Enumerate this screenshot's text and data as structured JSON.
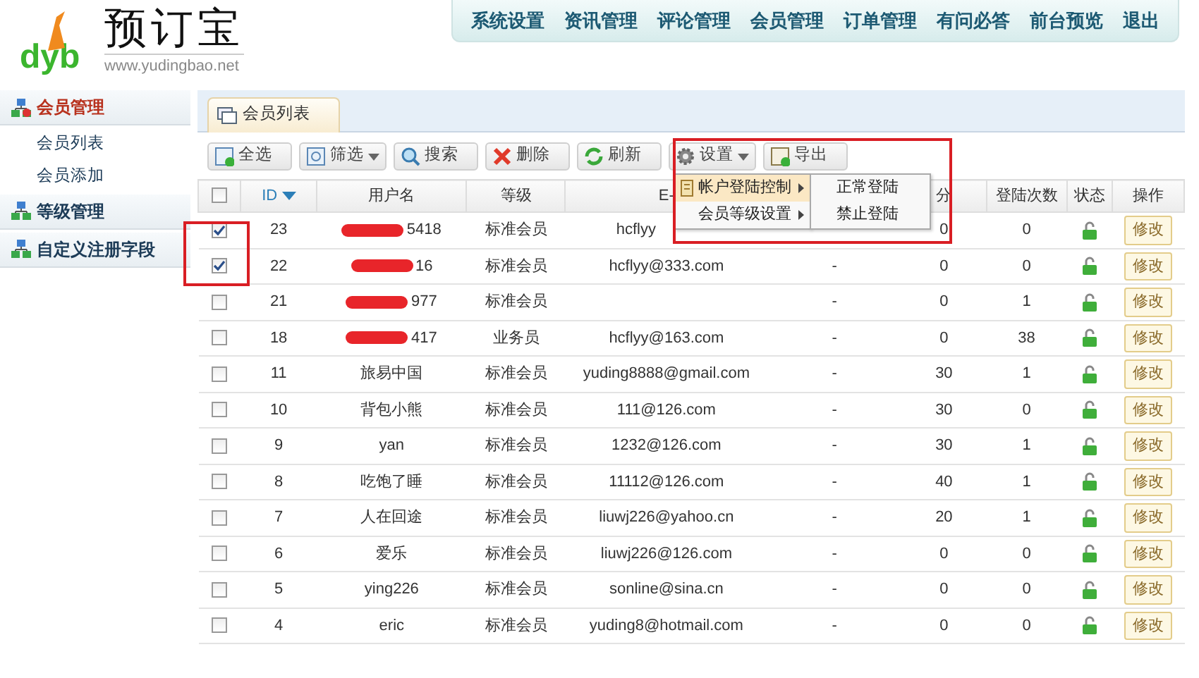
{
  "logo": {
    "name": "预订宝",
    "letters": "dyb",
    "url": "www.yudingbao.net"
  },
  "top_nav": [
    "系统设置",
    "资讯管理",
    "评论管理",
    "会员管理",
    "订单管理",
    "有问必答",
    "前台预览",
    "退出"
  ],
  "sidebar": [
    {
      "label": "会员管理",
      "active": true,
      "children": [
        {
          "label": "会员列表"
        },
        {
          "label": "会员添加"
        }
      ]
    },
    {
      "label": "等级管理",
      "active": false
    },
    {
      "label": "自定义注册字段",
      "active": false
    }
  ],
  "tab": {
    "label": "会员列表"
  },
  "toolbar": [
    {
      "label": "全选",
      "dropdown": false
    },
    {
      "label": "筛选",
      "dropdown": true
    },
    {
      "label": "搜索",
      "dropdown": false
    },
    {
      "label": "删除",
      "dropdown": false
    },
    {
      "label": "刷新",
      "dropdown": false
    },
    {
      "label": "设置",
      "dropdown": true
    },
    {
      "label": "导出",
      "dropdown": false
    }
  ],
  "table": {
    "header_checked": false,
    "checkbox_frame": true,
    "columns": [
      {
        "label": "ID",
        "sort_descending": true
      },
      {
        "label": "用户名"
      },
      {
        "label": "等级"
      },
      {
        "label": "E-"
      },
      {},
      {
        "label": "分"
      },
      {
        "label": "登陆次数"
      },
      {
        "label": "状态"
      },
      {
        "label": "操作"
      }
    ],
    "rows": [
      {
        "checked": true,
        "id": "23",
        "username": "5418",
        "redacted": true,
        "level": "标准会员",
        "email": "hcflyy",
        "points": "0",
        "logins": "0",
        "locked": false,
        "action": "修改"
      },
      {
        "checked": true,
        "id": "22",
        "username": "16",
        "redacted": true,
        "level": "标准会员",
        "email": "hcflyy@333.com",
        "column_6": "-",
        "points": "0",
        "logins": "0",
        "locked": false,
        "action": "修改"
      },
      {
        "checked": false,
        "id": "21",
        "username": "977",
        "redacted": true,
        "level": "标准会员",
        "column_6": "-",
        "points": "0",
        "logins": "1",
        "locked": false,
        "action": "修改"
      },
      {
        "checked": false,
        "id": "18",
        "username": "417",
        "redacted": true,
        "level": "业务员",
        "email": "hcflyy@163.com",
        "column_6": "-",
        "points": "0",
        "logins": "38",
        "locked": false,
        "action": "修改"
      },
      {
        "checked": false,
        "id": "11",
        "username": "旅易中国",
        "redacted": false,
        "level": "标准会员",
        "email": "yuding8888@gmail.com",
        "column_6": "-",
        "points": "30",
        "logins": "1",
        "locked": false,
        "action": "修改"
      },
      {
        "checked": false,
        "id": "10",
        "username": "背包小熊",
        "redacted": false,
        "level": "标准会员",
        "email": "111@126.com",
        "column_6": "-",
        "points": "30",
        "logins": "0",
        "locked": false,
        "action": "修改"
      },
      {
        "checked": false,
        "id": "9",
        "username": "yan",
        "redacted": false,
        "level": "标准会员",
        "email": "1232@126.com",
        "column_6": "-",
        "points": "30",
        "logins": "1",
        "locked": false,
        "action": "修改"
      },
      {
        "checked": false,
        "id": "8",
        "username": "吃饱了睡",
        "redacted": false,
        "level": "标准会员",
        "email": "11112@126.com",
        "column_6": "-",
        "points": "40",
        "logins": "1",
        "locked": false,
        "action": "修改"
      },
      {
        "checked": false,
        "id": "7",
        "username": "人在回途",
        "redacted": false,
        "level": "标准会员",
        "email": "liuwj226@yahoo.cn",
        "column_6": "-",
        "points": "20",
        "logins": "1",
        "locked": false,
        "action": "修改"
      },
      {
        "checked": false,
        "id": "6",
        "username": "爱乐",
        "redacted": false,
        "level": "标准会员",
        "email": "liuwj226@126.com",
        "column_6": "-",
        "points": "0",
        "logins": "0",
        "locked": false,
        "action": "修改"
      },
      {
        "checked": false,
        "id": "5",
        "username": "ying226",
        "redacted": false,
        "level": "标准会员",
        "email": "sonline@sina.cn",
        "column_6": "-",
        "points": "0",
        "logins": "0",
        "locked": false,
        "action": "修改"
      },
      {
        "checked": false,
        "id": "4",
        "username": "eric",
        "redacted": false,
        "level": "标准会员",
        "email": "yuding8@hotmail.com",
        "column_6": "-",
        "points": "0",
        "logins": "0",
        "locked": false,
        "action": "修改"
      }
    ]
  },
  "settings_menu": {
    "framed": true,
    "items": [
      {
        "label": "帐户登陆控制",
        "selected": true
      },
      {
        "label": "会员等级设置",
        "selected": false
      }
    ],
    "submenu": [
      {
        "label": "正常登陆"
      },
      {
        "label": "禁止登陆"
      }
    ]
  }
}
